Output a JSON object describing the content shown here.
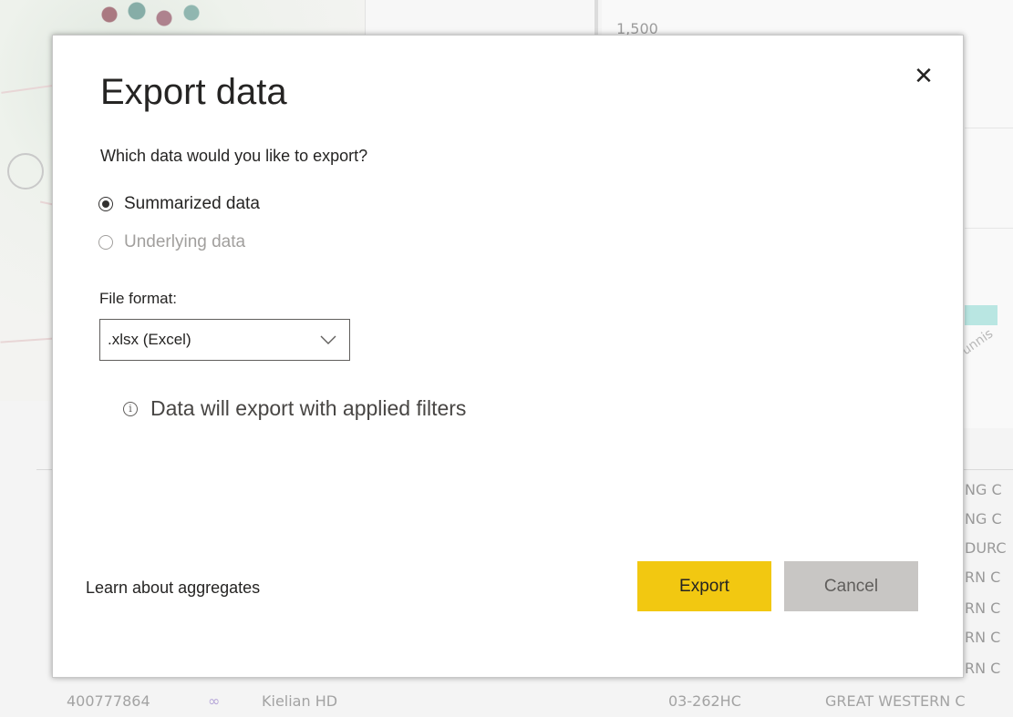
{
  "background": {
    "axis_tick": "1,500",
    "rotated_label": "unnis",
    "right_rows": [
      "NG C",
      "NG C",
      "DURC",
      "RN C",
      "RN C",
      "RN C",
      "RN C"
    ],
    "bottom_row": {
      "id": "400777864",
      "link_icon": "link-icon",
      "name": "Kielian HD",
      "code": "03-262HC",
      "company": "GREAT WESTERN C"
    }
  },
  "dialog": {
    "title": "Export data",
    "close_icon": "close-icon",
    "question": "Which data would you like to export?",
    "options": [
      {
        "label": "Summarized data",
        "selected": true,
        "enabled": true
      },
      {
        "label": "Underlying data",
        "selected": false,
        "enabled": false
      }
    ],
    "file_format_label": "File format:",
    "file_format_value": ".xlsx (Excel)",
    "info_text": "Data will export with applied filters",
    "learn_link": "Learn about aggregates",
    "export_label": "Export",
    "cancel_label": "Cancel"
  },
  "colors": {
    "export_button": "#f2c811",
    "cancel_button": "#c8c6c4",
    "text": "#252423"
  }
}
